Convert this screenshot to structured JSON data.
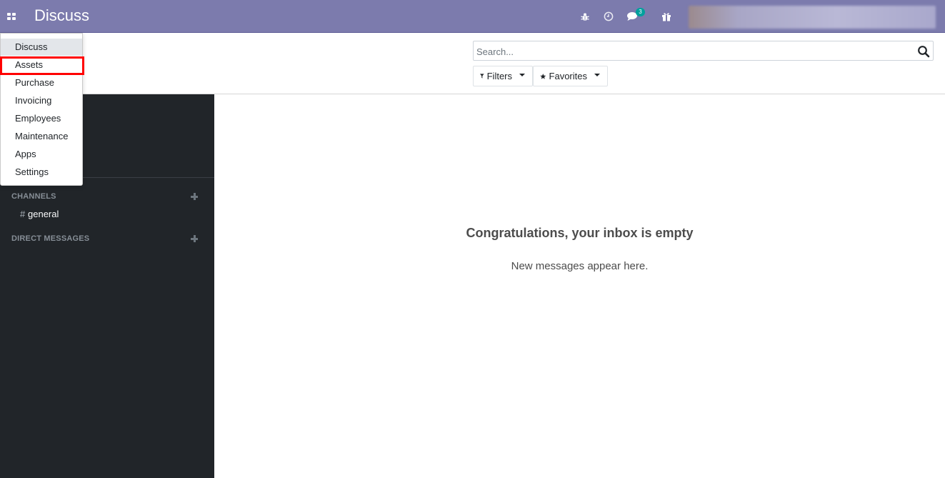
{
  "navbar": {
    "title": "Discuss",
    "chat_badge_count": "3",
    "icons": [
      "apps-grid-icon",
      "bug-icon",
      "clock-icon",
      "chat-icon",
      "gift-icon"
    ],
    "background_color": "#7c7bad"
  },
  "apps_menu": {
    "items": [
      "Discuss",
      "Assets",
      "Purchase",
      "Invoicing",
      "Employees",
      "Maintenance",
      "Apps",
      "Settings"
    ],
    "active_item": "Discuss",
    "highlighted_item": "Assets",
    "highlight_color": "#ff0000"
  },
  "search": {
    "placeholder": "Search...",
    "value": ""
  },
  "control_panel": {
    "filters_label": "Filters",
    "favorites_label": "Favorites"
  },
  "sidebar": {
    "channels_header": "CHANNELS",
    "channels": [
      {
        "prefix": "#",
        "name": "general"
      }
    ],
    "direct_messages_header": "DIRECT MESSAGES",
    "background_color": "#212529"
  },
  "main": {
    "empty_title": "Congratulations, your inbox is empty",
    "empty_subtitle": "New messages appear here."
  }
}
